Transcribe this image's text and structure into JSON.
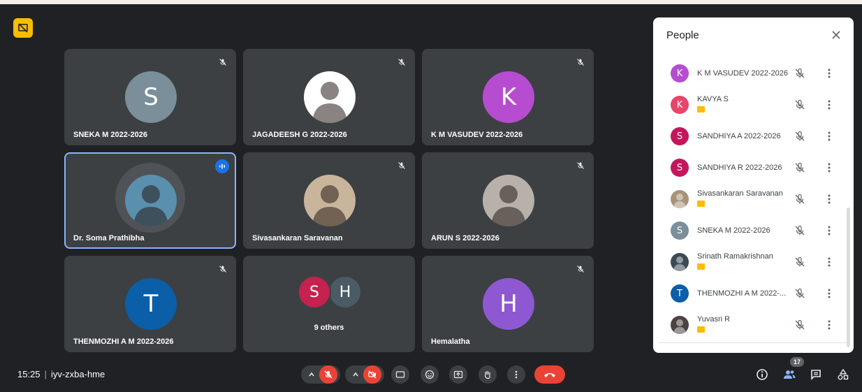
{
  "meeting": {
    "time": "15:25",
    "separator": "|",
    "code": "iyv-zxba-hme"
  },
  "tiles": [
    {
      "name": "SNEKA M 2022-2026",
      "initial": "S",
      "color": "#7a8f99",
      "muted": true
    },
    {
      "name": "JAGADEESH G 2022-2026",
      "initial": "",
      "color": "#ffffff",
      "muted": true
    },
    {
      "name": "K M VASUDEV 2022-2026",
      "initial": "K",
      "color": "#b64cd0",
      "muted": true
    },
    {
      "name": "Dr. Soma Prathibha",
      "initial": "",
      "color": "#5a8fae",
      "speaking": true
    },
    {
      "name": "Sivasankaran Saravanan",
      "initial": "",
      "color": "#c9b59b",
      "muted": true
    },
    {
      "name": "ARUN S 2022-2026",
      "initial": "",
      "color": "#b7b1aa",
      "muted": true
    },
    {
      "name": "THENMOZHI A M 2022-2026",
      "initial": "T",
      "color": "#0b5ea8",
      "muted": true
    },
    {
      "name": "Hemalatha",
      "initial": "H",
      "color": "#8e58d2",
      "muted": true
    }
  ],
  "others_tile": {
    "label": "9 others",
    "avatars": [
      {
        "initial": "S",
        "color": "#c5224f"
      },
      {
        "initial": "H",
        "color": "#4a5b66"
      }
    ]
  },
  "people_panel": {
    "title": "People",
    "participants": [
      {
        "name": "K M VASUDEV 2022-2026",
        "initial": "K",
        "color": "#b64cd0",
        "badge": false,
        "photo": false
      },
      {
        "name": "KAVYA S",
        "initial": "K",
        "color": "#e8456b",
        "badge": true,
        "photo": false
      },
      {
        "name": "SANDHIYA A 2022-2026",
        "initial": "S",
        "color": "#c2185b",
        "badge": false,
        "photo": false
      },
      {
        "name": "SANDHIYA R 2022-2026",
        "initial": "S",
        "color": "#c2185b",
        "badge": false,
        "photo": false
      },
      {
        "name": "Sivasankaran Saravanan",
        "initial": "",
        "color": "#a89279",
        "badge": true,
        "photo": true
      },
      {
        "name": "SNEKA M 2022-2026",
        "initial": "S",
        "color": "#7a8f99",
        "badge": false,
        "photo": false
      },
      {
        "name": "Srinath Ramakrishnan",
        "initial": "",
        "color": "#3b4a55",
        "badge": true,
        "photo": true
      },
      {
        "name": "THENMOZHI A M 2022-...",
        "initial": "T",
        "color": "#0b5ea8",
        "badge": false,
        "photo": false
      },
      {
        "name": "Yuvasri R",
        "initial": "",
        "color": "#4a4340",
        "badge": true,
        "photo": true
      }
    ]
  },
  "toolbar": {
    "mic_state": "muted",
    "camera_state": "off",
    "captions_label": "CC",
    "participant_count": "17"
  },
  "colors": {
    "background": "#202124",
    "tile": "#3c4043",
    "accent": "#8ab4f8",
    "danger": "#ea4335",
    "host_badge": "#fbbc04"
  }
}
